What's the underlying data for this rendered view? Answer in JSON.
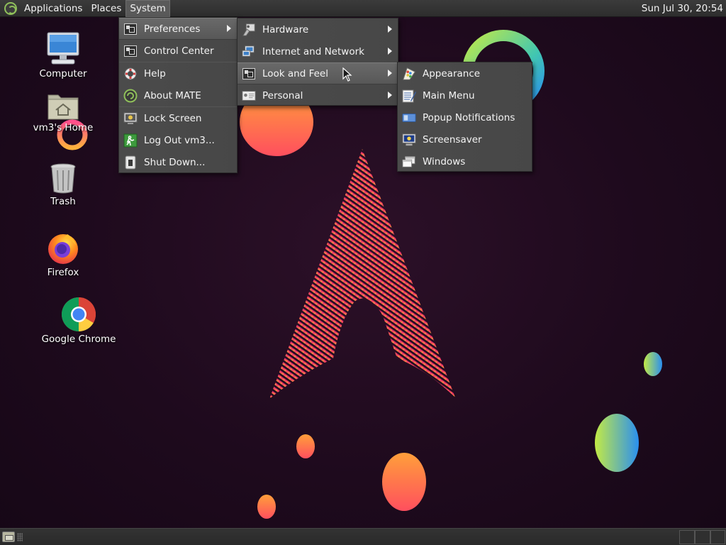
{
  "top_panel": {
    "menus": [
      "Applications",
      "Places",
      "System"
    ],
    "active_menu": "System",
    "clock": "Sun Jul 30, 20:54"
  },
  "desktop_icons": [
    {
      "label": "Computer",
      "icon": "computer-icon"
    },
    {
      "label": "vm3's Home",
      "icon": "home-folder-icon"
    },
    {
      "label": "Trash",
      "icon": "trash-icon"
    },
    {
      "label": "Firefox",
      "icon": "firefox-icon"
    },
    {
      "label": "Google Chrome",
      "icon": "chrome-icon"
    }
  ],
  "system_menu": {
    "items": [
      {
        "label": "Preferences",
        "icon": "preferences-icon",
        "submenu": true,
        "highlighted": true
      },
      {
        "label": "Control Center",
        "icon": "control-center-icon"
      },
      {
        "label": "Help",
        "icon": "help-icon"
      },
      {
        "label": "About MATE",
        "icon": "about-mate-icon"
      },
      {
        "label": "Lock Screen",
        "icon": "lock-screen-icon"
      },
      {
        "label": "Log Out vm3...",
        "icon": "log-out-icon"
      },
      {
        "label": "Shut Down...",
        "icon": "shut-down-icon"
      }
    ]
  },
  "preferences_menu": {
    "items": [
      {
        "label": "Hardware",
        "icon": "hardware-icon",
        "submenu": true
      },
      {
        "label": "Internet and Network",
        "icon": "network-icon",
        "submenu": true
      },
      {
        "label": "Look and Feel",
        "icon": "look-and-feel-icon",
        "submenu": true,
        "highlighted": true
      },
      {
        "label": "Personal",
        "icon": "personal-icon",
        "submenu": true
      }
    ]
  },
  "look_and_feel_menu": {
    "items": [
      {
        "label": "Appearance",
        "icon": "appearance-icon"
      },
      {
        "label": "Main Menu",
        "icon": "main-menu-icon"
      },
      {
        "label": "Popup Notifications",
        "icon": "notifications-icon"
      },
      {
        "label": "Screensaver",
        "icon": "screensaver-icon"
      },
      {
        "label": "Windows",
        "icon": "windows-icon"
      }
    ]
  },
  "colors": {
    "panel": "#2d2d2d",
    "menu_bg": "#4a4a4a",
    "menu_highlight": "#626262",
    "wallpaper": "#1e0a1d",
    "accent_pink": "#e8306e",
    "accent_orange": "#ff8a3c",
    "accent_green": "#b5e04a",
    "accent_blue": "#2a8ff0"
  }
}
